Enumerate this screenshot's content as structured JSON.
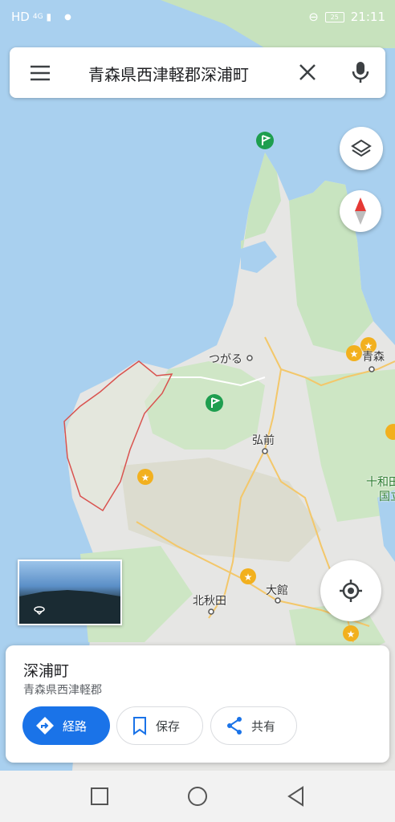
{
  "status": {
    "network": "HD",
    "signal": "4G",
    "battery_level": "25",
    "time": "21:11"
  },
  "search": {
    "query": "青森県西津軽郡深浦町"
  },
  "map": {
    "labels": {
      "tsugaru": "つがる",
      "aomori": "青森",
      "hirosaki": "弘前",
      "towada": "十和田",
      "kokuritsu": "国立",
      "kitaakita": "北秋田",
      "odate": "大館"
    }
  },
  "place_card": {
    "title": "深浦町",
    "subtitle": "青森県西津軽郡",
    "actions": {
      "directions": "経路",
      "save": "保存",
      "share": "共有"
    }
  },
  "colors": {
    "water": "#a9d0ef",
    "land": "#e8e8e6",
    "forest": "#c8e4c0",
    "accent": "#1a73e8",
    "boundary": "#d9534f"
  }
}
